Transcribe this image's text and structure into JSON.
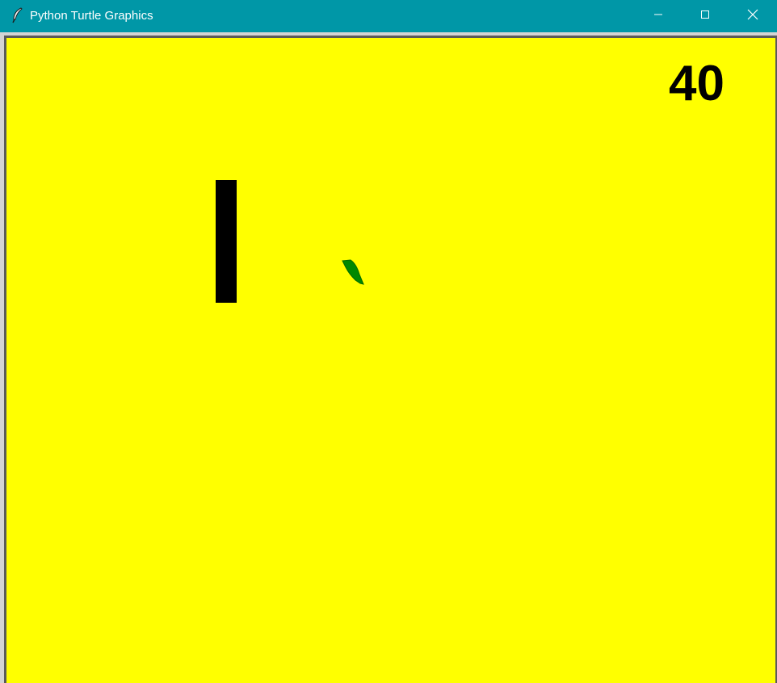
{
  "window": {
    "title": "Python Turtle Graphics",
    "titlebar_color": "#0097a7",
    "icon": "feather-icon",
    "controls": [
      "minimize-icon",
      "maximize-icon",
      "close-icon"
    ]
  },
  "game": {
    "background_color": "#ffff00",
    "score": "40",
    "paddle_color": "#000000",
    "ball_color": "#008800",
    "ball_shape": "turtle-icon"
  }
}
